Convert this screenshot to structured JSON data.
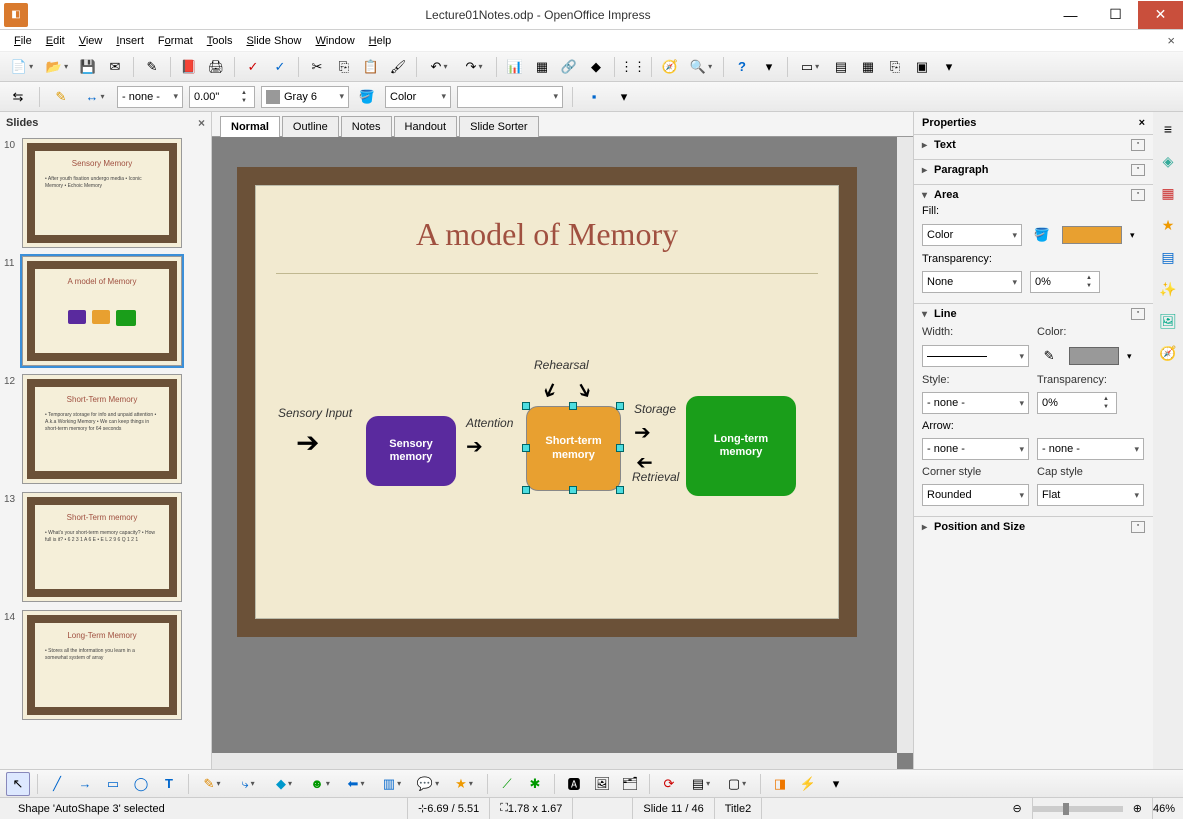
{
  "title": "Lecture01Notes.odp - OpenOffice Impress",
  "menu": {
    "file": "File",
    "edit": "Edit",
    "view": "View",
    "insert": "Insert",
    "format": "Format",
    "tools": "Tools",
    "slideshow": "Slide Show",
    "window": "Window",
    "help": "Help"
  },
  "toolbar2": {
    "linestyle": "- none -",
    "width": "0.00\"",
    "color": "Gray 6",
    "filltype": "Color"
  },
  "slidesPanel": {
    "title": "Slides"
  },
  "thumbs": [
    {
      "num": "10",
      "title": "Sensory Memory",
      "body": "• After youth fixation undergo media\n• Iconic Memory\n• Echoic Memory"
    },
    {
      "num": "11",
      "title": "A model of Memory",
      "body": ""
    },
    {
      "num": "12",
      "title": "Short-Term Memory",
      "body": "• Temporary storage for info and unpaid attention\n• A.k.a Working Memory\n• We can keep things in short-term memory for 64 seconds"
    },
    {
      "num": "13",
      "title": "Short-Term memory",
      "body": "• What's your short-term memory capacity?\n• How full is it?\n• 6 2 3 1 A 6 E\n• E L 2 9 6 Q 1 2 1"
    },
    {
      "num": "14",
      "title": "Long-Term Memory",
      "body": "• Stores all the information you learn in a somewhat system of array"
    }
  ],
  "viewtabs": {
    "normal": "Normal",
    "outline": "Outline",
    "notes": "Notes",
    "handout": "Handout",
    "sorter": "Slide Sorter"
  },
  "slide": {
    "title": "A model of Memory",
    "sensoryInput": "Sensory Input",
    "attention": "Attention",
    "rehearsal": "Rehearsal",
    "storage": "Storage",
    "retrieval": "Retrieval",
    "box1": "Sensory\nmemory",
    "box2": "Short-term\nmemory",
    "box3": "Long-term\nmemory"
  },
  "props": {
    "title": "Properties",
    "text": "Text",
    "paragraph": "Paragraph",
    "area": "Area",
    "line": "Line",
    "position": "Position and Size",
    "fill": "Fill:",
    "fillType": "Color",
    "transparency": "Transparency:",
    "transType": "None",
    "transVal": "0%",
    "width": "Width:",
    "colorLbl": "Color:",
    "style": "Style:",
    "styleVal": "- none -",
    "lineTrans": "0%",
    "arrow": "Arrow:",
    "arrowL": "- none -",
    "arrowR": "- none -",
    "corner": "Corner style",
    "cornerVal": "Rounded",
    "cap": "Cap style",
    "capVal": "Flat"
  },
  "status": {
    "sel": "Shape 'AutoShape 3' selected",
    "pos": "6.69 / 5.51",
    "size": "1.78 x 1.67",
    "slide": "Slide 11 / 46",
    "master": "Title2",
    "zoom": "46%"
  }
}
